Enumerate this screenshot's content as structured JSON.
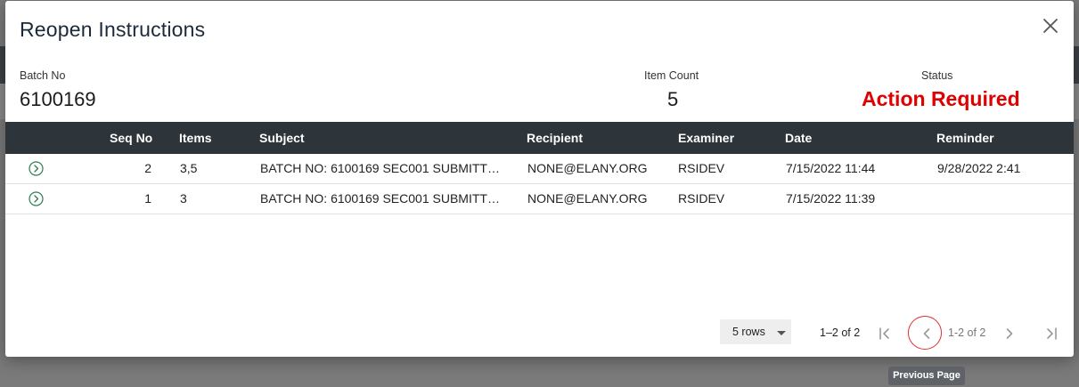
{
  "modal": {
    "title": "Reopen Instructions",
    "close_icon": "close-icon"
  },
  "summary": {
    "batch_label": "Batch No",
    "batch_value": "6100169",
    "count_label": "Item Count",
    "count_value": "5",
    "status_label": "Status",
    "status_value": "Action Required",
    "status_color": "#e00000"
  },
  "table": {
    "columns": [
      "Seq No",
      "Items",
      "Subject",
      "Recipient",
      "Examiner",
      "Date",
      "Reminder"
    ],
    "rows": [
      {
        "seq": "2",
        "items": "3,5",
        "subject": "BATCH NO: 6100169 SEC001 SUBMITTE…",
        "recipient": "NONE@ELANY.ORG",
        "examiner": "RSIDEV",
        "date": "7/15/2022 11:44",
        "reminder": "9/28/2022 2:41"
      },
      {
        "seq": "1",
        "items": "3",
        "subject": "BATCH NO: 6100169 SEC001 SUBMITTE…",
        "recipient": "NONE@ELANY.ORG",
        "examiner": "RSIDEV",
        "date": "7/15/2022 11:39",
        "reminder": ""
      }
    ],
    "header_color": "#2d343a",
    "expand_icon": "chevron-right-circle-icon"
  },
  "pagination": {
    "rows_per_page": "5 rows",
    "range": "1–2 of 2",
    "range_secondary": "1-2 of 2",
    "first_icon": "first-page-icon",
    "prev_icon": "chevron-left-icon",
    "next_icon": "chevron-right-icon",
    "last_icon": "last-page-icon"
  },
  "tooltip": {
    "text": "Previous Page"
  }
}
